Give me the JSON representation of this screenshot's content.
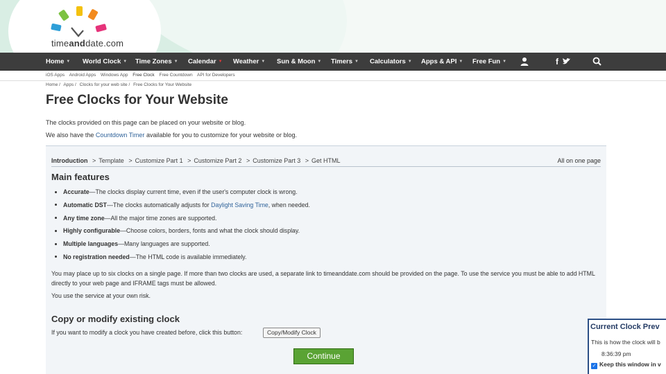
{
  "header": {
    "logo_text_a": "time",
    "logo_text_b": "and",
    "logo_text_c": "date",
    "logo_text_d": ".com"
  },
  "nav": {
    "items": [
      {
        "label": "Home"
      },
      {
        "label": "World Clock"
      },
      {
        "label": "Time Zones"
      },
      {
        "label": "Calendar"
      },
      {
        "label": "Weather"
      },
      {
        "label": "Sun & Moon"
      },
      {
        "label": "Timers"
      },
      {
        "label": "Calculators"
      },
      {
        "label": "Apps & API"
      },
      {
        "label": "Free Fun"
      }
    ],
    "icons": [
      "user-icon",
      "facebook-icon",
      "twitter-icon",
      "search-icon"
    ],
    "facebook_glyph": "f"
  },
  "subnav": {
    "items": [
      "iOS Apps",
      "Android Apps",
      "Windows App",
      "Free Clock",
      "Free Countdown",
      "API for Developers"
    ]
  },
  "breadcrumb": {
    "items": [
      "Home /",
      "Apps /",
      "Clocks for your web site /",
      "Free Clocks for Your Website"
    ]
  },
  "page": {
    "title": "Free Clocks for Your Website",
    "intro1": "The clocks provided on this page can be placed on your website or blog.",
    "intro2_a": "We also have the ",
    "intro2_link": "Countdown Timer",
    "intro2_b": " available for you to customize for your website or blog."
  },
  "steps": {
    "current": "Introduction",
    "rest": [
      "Template",
      "Customize Part 1",
      "Customize Part 2",
      "Customize Part 3",
      "Get HTML"
    ],
    "separator": ">",
    "all_on_one": "All on one page"
  },
  "features": {
    "heading": "Main features",
    "items": [
      {
        "bold": "Accurate",
        "text": "—The clocks display current time, even if the user's computer clock is wrong."
      },
      {
        "bold": "Automatic DST",
        "text": "—The clocks automatically adjusts for ",
        "link": "Daylight Saving Time",
        "text2": ", when needed."
      },
      {
        "bold": "Any time zone",
        "text": "—All the major time zones are supported."
      },
      {
        "bold": "Highly configurable",
        "text": "—Choose colors, borders, fonts and what the clock should display."
      },
      {
        "bold": "Multiple languages",
        "text": "—Many languages are supported."
      },
      {
        "bold": "No registration needed",
        "text": "—The HTML code is available immediately."
      }
    ],
    "para1": "You may place up to six clocks on a single page. If more than two clocks are used, a separate link to timeanddate.com should be provided on the page. To use the service you must be able to add HTML directly to your web page and IFRAME tags must be allowed.",
    "para2": "You use the service at your own risk."
  },
  "copy": {
    "heading": "Copy or modify existing clock",
    "prompt": "If you want to modify a clock you have created before, click this button:",
    "button": "Copy/Modify Clock",
    "continue": "Continue"
  },
  "preview": {
    "title": "Current Clock Prev",
    "desc": "This is how the clock will b",
    "time": "8:36:39 pm",
    "keep": "Keep this window in v",
    "keep_checked": true
  },
  "colors": {
    "nav_bg": "#3d3d3d",
    "link": "#30639a",
    "continue_bg": "#5aa334",
    "preview_border": "#2c4f86"
  }
}
